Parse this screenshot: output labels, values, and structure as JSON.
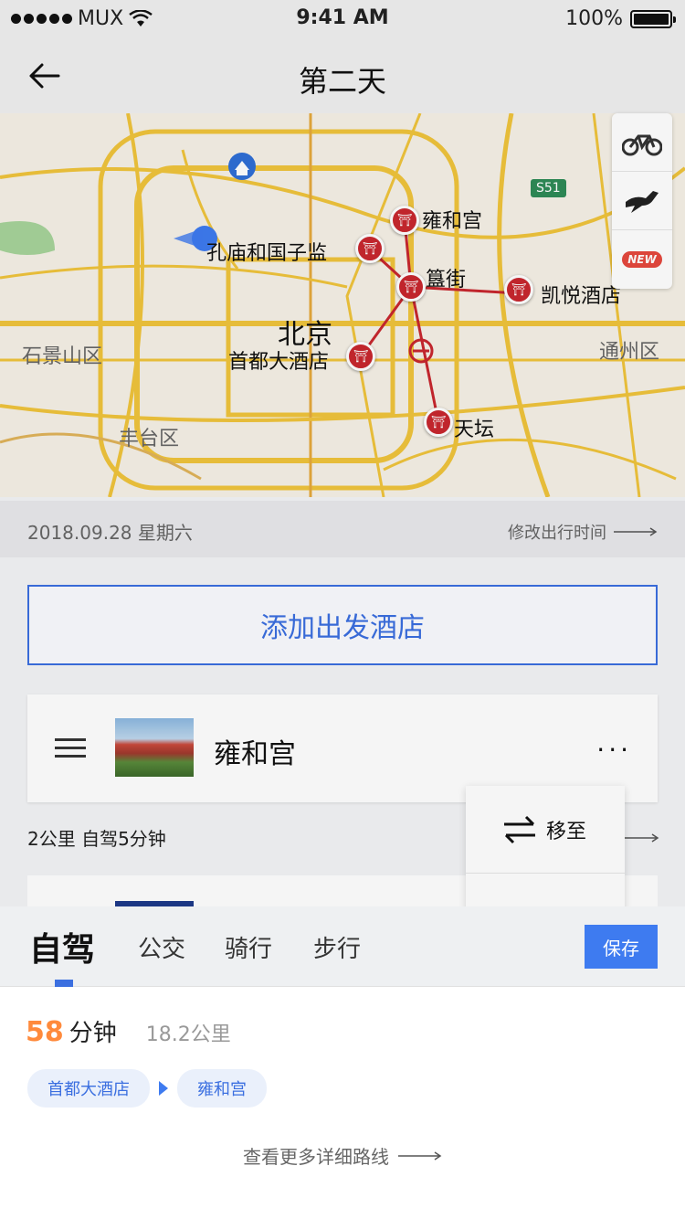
{
  "status_bar": {
    "carrier": "MUX",
    "time": "9:41 AM",
    "battery": "100%"
  },
  "nav": {
    "title": "第二天"
  },
  "map": {
    "labels": {
      "yonghegong": "雍和宫",
      "kongmiao": "孔庙和国子监",
      "guijie": "簋街",
      "kaiyue": "凯悦酒店",
      "beijing": "北京",
      "shoudu": "首都大酒店",
      "tiantan": "天坛",
      "shijingshan": "石景山区",
      "fengtai": "丰台区",
      "tongzhou": "通州区",
      "s51": "S51"
    },
    "tools": [
      "bike-icon",
      "horse-icon",
      "new-badge"
    ],
    "new_badge": "NEW"
  },
  "date_row": {
    "date": "2018.09.28   星期六",
    "modify": "修改出行时间"
  },
  "add_hotel": {
    "label": "添加出发酒店"
  },
  "poi": {
    "name": "雍和宫",
    "more": "···"
  },
  "distance": {
    "text": "2公里    自驾5分钟"
  },
  "popup": {
    "move_to": "移至"
  },
  "transport": {
    "tabs": [
      "自驾",
      "公交",
      "骑行",
      "步行"
    ],
    "active": "自驾",
    "save_label": "保存"
  },
  "route": {
    "minutes": "58",
    "unit": "分钟",
    "km": "18.2公里",
    "from": "首都大酒店",
    "to": "雍和宫",
    "detail_link": "查看更多详细路线"
  },
  "colors": {
    "accent": "#3e7bf0",
    "pin": "#c8272e",
    "highlight": "#ff8a3c"
  }
}
